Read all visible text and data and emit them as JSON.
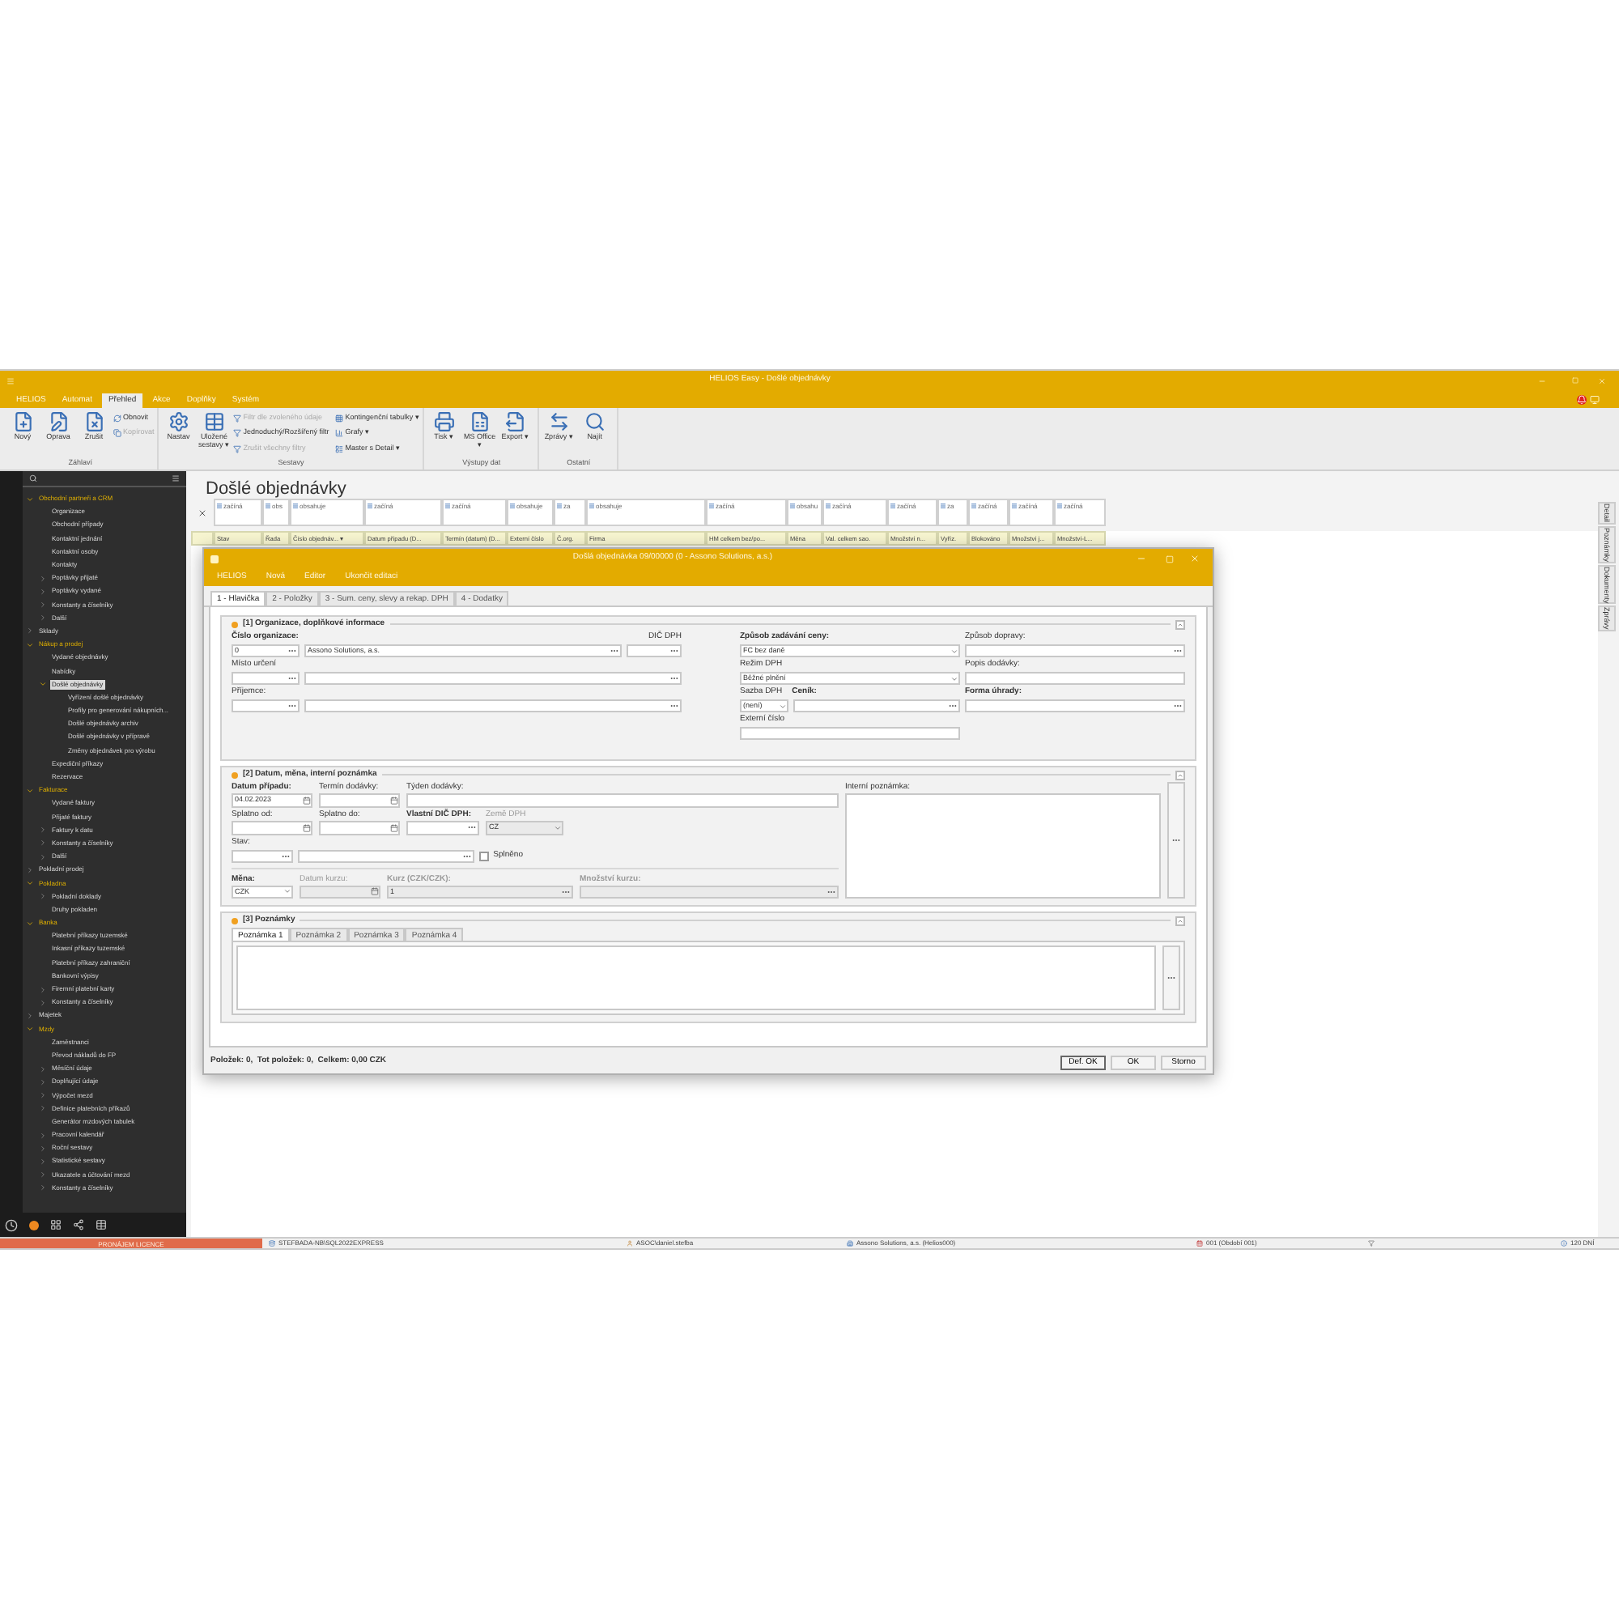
{
  "window": {
    "title": "HELIOS Easy - Došlé objednávky"
  },
  "menu": [
    {
      "label": "HELIOS",
      "selected": false
    },
    {
      "label": "Automat",
      "selected": false
    },
    {
      "label": "Přehled",
      "selected": true
    },
    {
      "label": "Akce",
      "selected": false
    },
    {
      "label": "Doplňky",
      "selected": false
    },
    {
      "label": "Systém",
      "selected": false
    }
  ],
  "ribbon": [
    {
      "label": "Záhlaví",
      "buttons": [
        {
          "label": "Nový",
          "kind": "large",
          "disabled": false
        },
        {
          "label": "Oprava",
          "kind": "large",
          "disabled": false
        },
        {
          "label": "Zrušit",
          "kind": "large",
          "disabled": false
        },
        {
          "label": "Obnovit",
          "kind": "small",
          "disabled": false
        },
        {
          "label": "Kopírovat",
          "kind": "small",
          "disabled": true
        }
      ]
    },
    {
      "label": "Sestavy",
      "buttons": [
        {
          "label": "Nastav",
          "kind": "large",
          "disabled": false
        },
        {
          "label": "Uložené sestavy ▾",
          "kind": "large",
          "disabled": false
        },
        {
          "label": "Filtr dle zvoleného údaje",
          "kind": "small",
          "disabled": true
        },
        {
          "label": "Jednoduchý/Rozšířený filtr",
          "kind": "small",
          "disabled": false
        },
        {
          "label": "Zrušit všechny filtry",
          "kind": "small",
          "disabled": true
        },
        {
          "label": "Kontingenční tabulky ▾",
          "kind": "small",
          "disabled": false
        },
        {
          "label": "Grafy ▾",
          "kind": "small",
          "disabled": false
        },
        {
          "label": "Master s Detail ▾",
          "kind": "small",
          "disabled": false
        }
      ]
    },
    {
      "label": "Výstupy dat",
      "buttons": [
        {
          "label": "Tisk ▾",
          "kind": "large",
          "disabled": false
        },
        {
          "label": "MS Office ▾",
          "kind": "large",
          "disabled": false
        },
        {
          "label": "Export ▾",
          "kind": "large",
          "disabled": false
        }
      ]
    },
    {
      "label": "Ostatní",
      "buttons": [
        {
          "label": "Zprávy ▾",
          "kind": "large",
          "disabled": false
        },
        {
          "label": "Najít",
          "kind": "large",
          "disabled": false
        }
      ]
    }
  ],
  "sidebar": {
    "tree": [
      {
        "label": "Obchodní partneři a CRM",
        "expandable": true,
        "expanded": true,
        "selected": false,
        "children": [
          {
            "label": "Organizace",
            "expandable": false,
            "selected": false
          },
          {
            "label": "Obchodní případy",
            "expandable": false,
            "selected": false
          },
          {
            "label": "Kontaktní jednání",
            "expandable": false,
            "selected": false
          },
          {
            "label": "Kontaktní osoby",
            "expandable": false,
            "selected": false
          },
          {
            "label": "Kontakty",
            "expandable": false,
            "selected": false
          },
          {
            "label": "Poptávky přijaté",
            "expandable": true,
            "expanded": false,
            "selected": false
          },
          {
            "label": "Poptávky vydané",
            "expandable": true,
            "expanded": false,
            "selected": false
          },
          {
            "label": "Konstanty a číselníky",
            "expandable": true,
            "expanded": false,
            "selected": false
          },
          {
            "label": "Další",
            "expandable": true,
            "expanded": false,
            "selected": false
          }
        ]
      },
      {
        "label": "Sklady",
        "expandable": true,
        "expanded": false,
        "selected": false
      },
      {
        "label": "Nákup a prodej",
        "expandable": true,
        "expanded": true,
        "selected": false,
        "children": [
          {
            "label": "Vydané objednávky",
            "expandable": false,
            "selected": false
          },
          {
            "label": "Nabídky",
            "expandable": false,
            "selected": false
          },
          {
            "label": "Došlé objednávky",
            "expandable": true,
            "expanded": true,
            "selected": true,
            "children": [
              {
                "label": "Vyřízení došlé objednávky",
                "expandable": false,
                "selected": false
              },
              {
                "label": "Profily pro generování nákupních...",
                "expandable": false,
                "selected": false
              },
              {
                "label": "Došlé objednávky archiv",
                "expandable": false,
                "selected": false
              },
              {
                "label": "Došlé objednávky v přípravě",
                "expandable": false,
                "selected": false
              },
              {
                "label": "Změny objednávek pro výrobu",
                "expandable": false,
                "selected": false
              }
            ]
          },
          {
            "label": "Expediční příkazy",
            "expandable": false,
            "selected": false
          },
          {
            "label": "Rezervace",
            "expandable": false,
            "selected": false
          }
        ]
      },
      {
        "label": "Fakturace",
        "expandable": true,
        "expanded": true,
        "selected": false,
        "children": [
          {
            "label": "Vydané faktury",
            "expandable": false,
            "selected": false
          },
          {
            "label": "Přijaté faktury",
            "expandable": false,
            "selected": false
          },
          {
            "label": "Faktury k datu",
            "expandable": true,
            "expanded": false,
            "selected": false
          },
          {
            "label": "Konstanty a číselníky",
            "expandable": true,
            "expanded": false,
            "selected": false
          },
          {
            "label": "Další",
            "expandable": true,
            "expanded": false,
            "selected": false
          }
        ]
      },
      {
        "label": "Pokladní prodej",
        "expandable": true,
        "expanded": false,
        "selected": false
      },
      {
        "label": "Pokladna",
        "expandable": true,
        "expanded": true,
        "selected": false,
        "children": [
          {
            "label": "Pokladní doklady",
            "expandable": true,
            "expanded": false,
            "selected": false
          },
          {
            "label": "Druhy pokladen",
            "expandable": false,
            "selected": false
          }
        ]
      },
      {
        "label": "Banka",
        "expandable": true,
        "expanded": true,
        "selected": false,
        "children": [
          {
            "label": "Platební příkazy tuzemské",
            "expandable": false,
            "selected": false
          },
          {
            "label": "Inkasní příkazy tuzemské",
            "expandable": false,
            "selected": false
          },
          {
            "label": "Platební příkazy zahraniční",
            "expandable": false,
            "selected": false
          },
          {
            "label": "Bankovní výpisy",
            "expandable": false,
            "selected": false
          },
          {
            "label": "Firemní platební karty",
            "expandable": true,
            "expanded": false,
            "selected": false
          },
          {
            "label": "Konstanty a číselníky",
            "expandable": true,
            "expanded": false,
            "selected": false
          }
        ]
      },
      {
        "label": "Majetek",
        "expandable": true,
        "expanded": false,
        "selected": false
      },
      {
        "label": "Mzdy",
        "expandable": true,
        "expanded": true,
        "selected": false,
        "children": [
          {
            "label": "Zaměstnanci",
            "expandable": false,
            "selected": false
          },
          {
            "label": "Převod nákladů do FP",
            "expandable": false,
            "selected": false
          },
          {
            "label": "Měsíční údaje",
            "expandable": true,
            "expanded": false,
            "selected": false
          },
          {
            "label": "Doplňující údaje",
            "expandable": true,
            "expanded": false,
            "selected": false
          },
          {
            "label": "Výpočet mezd",
            "expandable": true,
            "expanded": false,
            "selected": false
          },
          {
            "label": "Definice platebních příkazů",
            "expandable": true,
            "expanded": false,
            "selected": false
          },
          {
            "label": "Generátor mzdových tabulek",
            "expandable": false,
            "selected": false
          },
          {
            "label": "Pracovní kalendář",
            "expandable": true,
            "expanded": false,
            "selected": false
          },
          {
            "label": "Roční sestavy",
            "expandable": true,
            "expanded": false,
            "selected": false
          },
          {
            "label": "Statistické sestavy",
            "expandable": true,
            "expanded": false,
            "selected": false
          },
          {
            "label": "Ukazatele a účtování mezd",
            "expandable": true,
            "expanded": false,
            "selected": false
          },
          {
            "label": "Konstanty a číselníky",
            "expandable": true,
            "expanded": false,
            "selected": false
          }
        ]
      }
    ]
  },
  "page_title": "Došlé objednávky",
  "table": {
    "columns": [
      {
        "filter": "začíná",
        "heading": "Stav"
      },
      {
        "filter": "obs",
        "heading": "Řada"
      },
      {
        "filter": "obsahuje",
        "heading": "Číslo objednáv... ▾"
      },
      {
        "filter": "začíná",
        "heading": "Datum případu (D..."
      },
      {
        "filter": "začíná",
        "heading": "Termín (datum) (D..."
      },
      {
        "filter": "obsahuje",
        "heading": "Externí číslo"
      },
      {
        "filter": "za",
        "heading": "Č.org."
      },
      {
        "filter": "obsahuje",
        "heading": "Firma"
      },
      {
        "filter": "začíná",
        "heading": "HM celkem bez/po..."
      },
      {
        "filter": "obsahu",
        "heading": "Měna"
      },
      {
        "filter": "začíná",
        "heading": "Val. celkem sao."
      },
      {
        "filter": "začíná",
        "heading": "Množství n..."
      },
      {
        "filter": "za",
        "heading": "Vyříz."
      },
      {
        "filter": "začíná",
        "heading": "Blokováno"
      },
      {
        "filter": "začíná",
        "heading": "Množství j..."
      },
      {
        "filter": "začíná",
        "heading": "Množství-L..."
      }
    ]
  },
  "side_tabs": [
    "Detail",
    "Poznámky",
    "Dokumenty",
    "Zprávy"
  ],
  "dialog": {
    "title": "Došlá objednávka 09/00000 (0 - Assono Solutions, a.s.)",
    "menu": [
      "HELIOS",
      "Nová",
      "Editor",
      "Ukončit editaci"
    ],
    "tabs": [
      {
        "label": "1 - Hlavička",
        "selected": true
      },
      {
        "label": "2 - Položky",
        "selected": false
      },
      {
        "label": "3 - Sum. ceny, slevy a rekap. DPH",
        "selected": false
      },
      {
        "label": "4 - Dodatky",
        "selected": false
      }
    ],
    "section1": {
      "title": "[1] Organizace, doplňkové informace",
      "org": {
        "label": "Číslo organizace:",
        "number": "0",
        "name": "Assono Solutions, a.s.",
        "required": true
      },
      "dic": {
        "label": "DIČ DPH",
        "required": false
      },
      "destination": {
        "label": "Místo určení",
        "required": false
      },
      "recipient": {
        "label": "Příjemce:",
        "required": false
      },
      "price_mode": {
        "label": "Způsob zadávání ceny:",
        "value": "FC bez daně",
        "required": true
      },
      "shipping": {
        "label": "Způsob dopravy:",
        "required": false
      },
      "vat_mode": {
        "label": "Režim DPH",
        "value": "Běžné plnění",
        "required": false
      },
      "delivery_desc": {
        "label": "Popis dodávky:",
        "required": false
      },
      "vat_rate": {
        "label": "Sazba DPH",
        "value": "(není)",
        "required": false
      },
      "pricelist": {
        "label": "Ceník:",
        "required": true
      },
      "payment": {
        "label": "Forma úhrady:",
        "required": true
      },
      "external": {
        "label": "Externí číslo",
        "required": false
      }
    },
    "section2": {
      "title": "[2] Datum, měna, interní poznámka",
      "date": {
        "label": "Datum případu:",
        "value": "04.02.2023",
        "required": true
      },
      "delivery_term": {
        "label": "Termín dodávky:",
        "required": false
      },
      "delivery_week": {
        "label": "Týden dodávky:",
        "required": false
      },
      "due_from": {
        "label": "Splatno od:",
        "required": false
      },
      "due_to": {
        "label": "Splatno do:",
        "required": false
      },
      "own_vat": {
        "label": "Vlastní DIČ DPH:",
        "required": true
      },
      "vat_country": {
        "label": "Země DPH",
        "value": "CZ",
        "required": false,
        "disabled": true
      },
      "status": {
        "label": "Stav:",
        "required": false
      },
      "fulfilled": {
        "label": "Splněno",
        "checked": false
      },
      "currency": {
        "label": "Měna:",
        "value": "CZK",
        "required": true
      },
      "rate_date": {
        "label": "Datum kurzu:",
        "required": false,
        "disabled": true
      },
      "rate": {
        "label": "Kurz (CZK/CZK):",
        "value": "1",
        "required": true,
        "disabled": true
      },
      "rate_amount": {
        "label": "Množství kurzu:",
        "required": true,
        "disabled": true
      },
      "internal_note": {
        "label": "Interní poznámka:"
      }
    },
    "section3": {
      "title": "[3] Poznámky",
      "tabs": [
        {
          "label": "Poznámka 1",
          "selected": true
        },
        {
          "label": "Poznámka 2",
          "selected": false
        },
        {
          "label": "Poznámka 3",
          "selected": false
        },
        {
          "label": "Poznámka 4",
          "selected": false
        }
      ]
    },
    "footer": "Položek: 0,  Tot položek: 0,  Celkem: 0,00 CZK",
    "buttons": [
      {
        "label": "Def. OK",
        "default": true
      },
      {
        "label": "OK",
        "default": false
      },
      {
        "label": "Storno",
        "default": false
      }
    ]
  },
  "status_bar": {
    "license": "PRONÁJEM LICENCE",
    "server": "STEFBADA-NB\\SQL2022EXPRESS",
    "user": "ASOC\\daniel.stefba",
    "company": "Assono Solutions, a.s. (Helios000)",
    "period": "001 (Období 001)",
    "days": "120 DNÍ"
  }
}
